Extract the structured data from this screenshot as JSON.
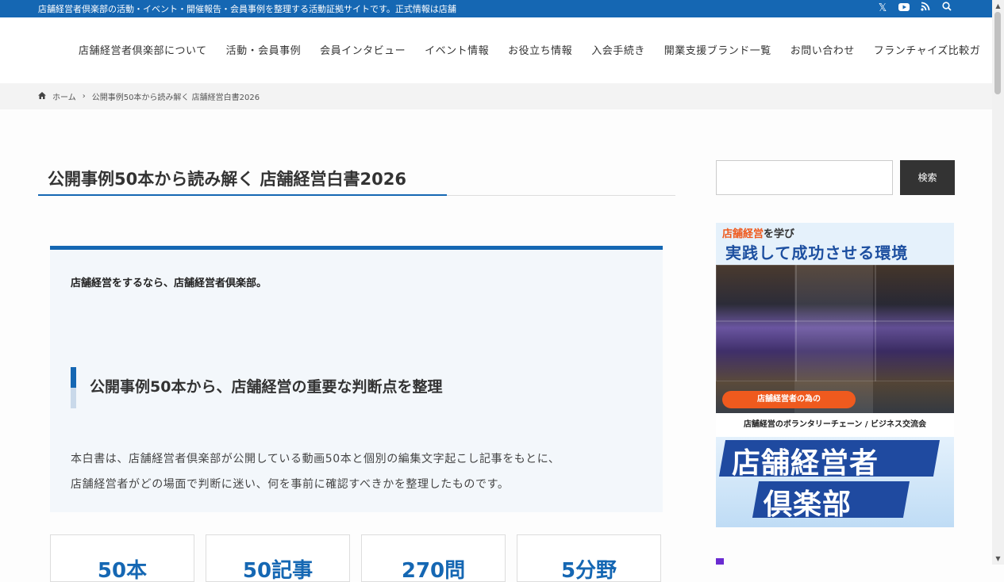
{
  "topbar": {
    "message": "店舗経営者倶楽部の活動・イベント・開催報告・会員事例を整理する活動証拠サイトです。正式情報は店舗",
    "icons": [
      "x-icon",
      "youtube-icon",
      "rss-icon",
      "search-icon"
    ]
  },
  "nav": {
    "items": [
      "店舗経営者倶楽部について",
      "活動・会員事例",
      "会員インタビュー",
      "イベント情報",
      "お役立ち情報",
      "入会手続き",
      "開業支援ブランド一覧",
      "お問い合わせ",
      "フランチャイズ比較ガ"
    ]
  },
  "breadcrumb": {
    "home": "ホーム",
    "separator": "›",
    "current": "公開事例50本から読み解く 店舗経営白書2026"
  },
  "article": {
    "title": "公開事例50本から読み解く 店舗経営白書2026",
    "lead": "店舗経営をするなら、店舗経営者倶楽部。",
    "section_heading": "公開事例50本から、店舗経営の重要な判断点を整理",
    "body_line1": "本白書は、店舗経営者倶楽部が公開している動画50本と個別の編集文字起こし記事をもとに、",
    "body_line2": "店舗経営者がどの場面で判断に迷い、何を事前に確認すべきかを整理したものです。",
    "stats": [
      "50本",
      "50記事",
      "270問",
      "5分野"
    ]
  },
  "sidebar": {
    "search_placeholder": "",
    "search_button": "検索",
    "banner": {
      "line1_highlight": "店舗経営",
      "line1_rest": "を学び",
      "line2": "実践して成功させる環境",
      "pill": "店舗経営者の為の",
      "subtitle": "店舗経営のボランタリーチェーン / ビジネス交流会",
      "big1": "店舗経営者",
      "big2": "倶楽部"
    }
  },
  "colors": {
    "brand_blue": "#1567b3",
    "accent_orange": "#ef5a1e",
    "button_dark": "#333333"
  }
}
